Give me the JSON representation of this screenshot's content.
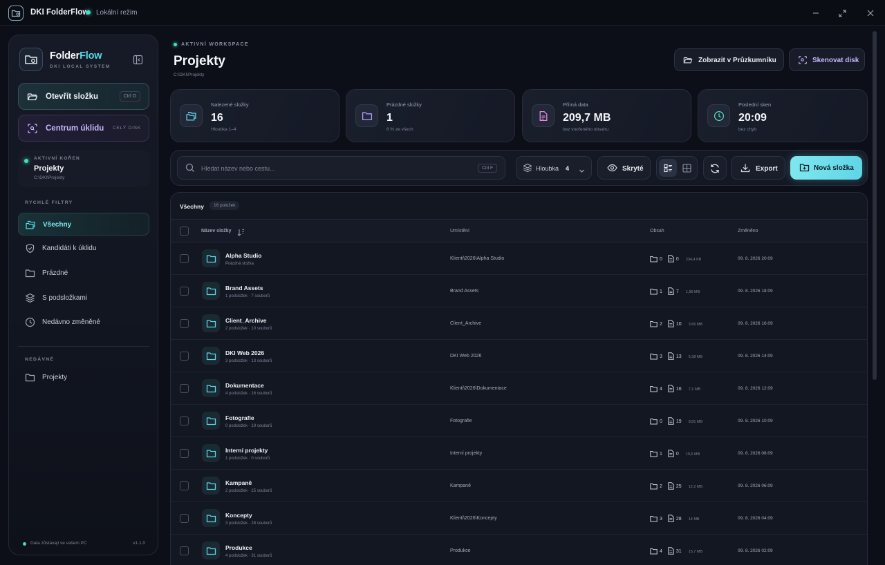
{
  "titlebar": {
    "app_name": "DKI FolderFlow",
    "mode": "Lokální režim"
  },
  "sidebar": {
    "brand_a": "Folder",
    "brand_b": "Flow",
    "brand_sub": "DKI LOCAL SYSTEM",
    "open_label": "Otevřít složku",
    "open_kbd": "Ctrl O",
    "clean_label": "Centrum úklidu",
    "clean_tag": "CELÝ DISK",
    "root_head": "AKTIVNÍ KOŘEN",
    "root_name": "Projekty",
    "root_path": "C:\\DKI\\Projekty",
    "filters_head": "RYCHLÉ FILTRY",
    "filters": [
      {
        "label": "Všechny"
      },
      {
        "label": "Kandidáti k úklidu"
      },
      {
        "label": "Prázdné"
      },
      {
        "label": "S podsložkami"
      },
      {
        "label": "Nedávno změněné"
      }
    ],
    "recent_head": "NEDÁVNÉ",
    "recent": [
      {
        "label": "Projekty"
      }
    ],
    "footer_text": "Data zůstávají ve vašem PC",
    "version": "v1.1.0"
  },
  "header": {
    "ws_label": "AKTIVNÍ WORKSPACE",
    "title": "Projekty",
    "path": "C:\\DKI\\Projekty",
    "explorer_btn": "Zobrazit v Průzkumníku",
    "scan_btn": "Skenovat disk"
  },
  "stats": [
    {
      "label": "Nalezené složky",
      "value": "16",
      "sub": "Hloubka 1–4",
      "icon": "folders-icon",
      "color": "#5fd5e6"
    },
    {
      "label": "Prázdné složky",
      "value": "1",
      "sub": "6 % ze všech",
      "icon": "folder-icon",
      "color": "#b69cff"
    },
    {
      "label": "Přímá data",
      "value": "209,7 MB",
      "sub": "bez vnořeného obsahu",
      "icon": "file-icon",
      "color": "#e58be0"
    },
    {
      "label": "Poslední sken",
      "value": "20:09",
      "sub": "bez chyb",
      "icon": "clock-icon",
      "color": "#4fe0b8"
    }
  ],
  "toolbar": {
    "search_placeholder": "Hledat název nebo cestu...",
    "search_kbd": "Ctrl F",
    "depth_label": "Hloubka",
    "depth_value": "4",
    "hidden_label": "Skryté",
    "export_label": "Export",
    "new_label": "Nová složka"
  },
  "table": {
    "tab_all": "Všechny",
    "tab_count": "16 položek",
    "headers": {
      "name": "Název složky",
      "location": "Umístění",
      "content": "Obsah",
      "modified": "Změněno"
    },
    "rows": [
      {
        "name": "Alpha Studio",
        "sub": "Prázdná složka",
        "path": "Klienti\\2026\\Alpha Studio",
        "dirs": "0",
        "files": "0",
        "size": "234,4 KB",
        "date": "09. 8. 2026 20:09"
      },
      {
        "name": "Brand Assets",
        "sub": "1 podsložek · 7 souborů",
        "path": "Brand Assets",
        "dirs": "1",
        "files": "7",
        "size": "1,95 MB",
        "date": "09. 8. 2026 18:09"
      },
      {
        "name": "Client_Archive",
        "sub": "2 podsložek · 10 souborů",
        "path": "Client_Archive",
        "dirs": "2",
        "files": "10",
        "size": "3,66 MB",
        "date": "09. 8. 2026 16:09"
      },
      {
        "name": "DKI Web 2026",
        "sub": "3 podsložek · 13 souborů",
        "path": "DKI Web 2026",
        "dirs": "3",
        "files": "13",
        "size": "5,38 MB",
        "date": "09. 8. 2026 14:09"
      },
      {
        "name": "Dokumentace",
        "sub": "4 podsložek · 16 souborů",
        "path": "Klienti\\2026\\Dokumentace",
        "dirs": "4",
        "files": "16",
        "size": "7,1 MB",
        "date": "09. 8. 2026 12:09"
      },
      {
        "name": "Fotografie",
        "sub": "0 podsložek · 19 souborů",
        "path": "Fotografie",
        "dirs": "0",
        "files": "19",
        "size": "8,81 MB",
        "date": "09. 8. 2026 10:09"
      },
      {
        "name": "Interní projekty",
        "sub": "1 podsložek · 0 souborů",
        "path": "Interní projekty",
        "dirs": "1",
        "files": "0",
        "size": "10,5 MB",
        "date": "09. 8. 2026 08:09"
      },
      {
        "name": "Kampaně",
        "sub": "2 podsložek · 25 souborů",
        "path": "Kampaně",
        "dirs": "2",
        "files": "25",
        "size": "12,2 MB",
        "date": "09. 8. 2026 06:09"
      },
      {
        "name": "Koncepty",
        "sub": "3 podsložek · 28 souborů",
        "path": "Klienti\\2026\\Koncepty",
        "dirs": "3",
        "files": "28",
        "size": "14 MB",
        "date": "09. 8. 2026 04:09"
      },
      {
        "name": "Produkce",
        "sub": "4 podsložek · 31 souborů",
        "path": "Produkce",
        "dirs": "4",
        "files": "31",
        "size": "15,7 MB",
        "date": "09. 8. 2026 02:09"
      }
    ]
  }
}
